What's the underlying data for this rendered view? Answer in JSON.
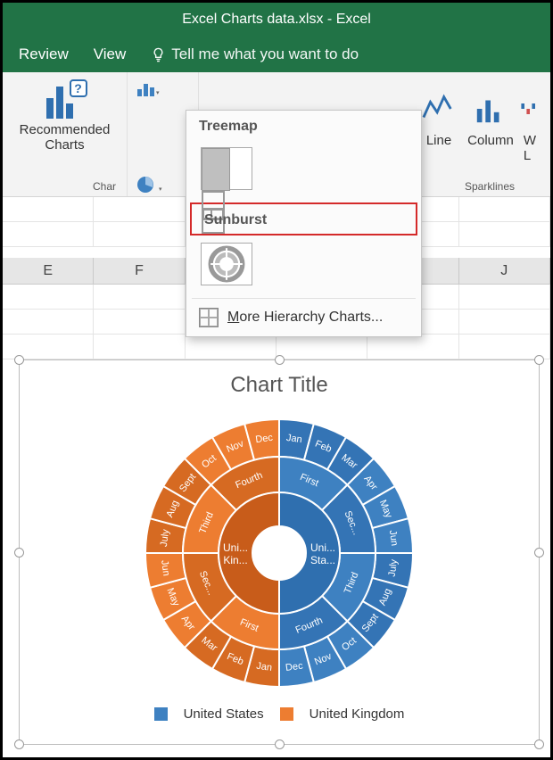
{
  "window": {
    "title": "Excel Charts data.xlsx - Excel"
  },
  "menu": {
    "review": "Review",
    "view": "View",
    "tellme": "Tell me what you want to do"
  },
  "ribbon": {
    "recommended": {
      "line1": "Recommended",
      "line2": "Charts"
    },
    "group_charts": "Char",
    "sparklines": {
      "line": "Line",
      "column": "Column",
      "winloss_initial": "W",
      "winloss_rest": "L",
      "group_label": "Sparklines"
    }
  },
  "dropdown": {
    "treemap_header": "Treemap",
    "sunburst_header": "Sunburst",
    "more_prefix": "M",
    "more_rest": "ore Hierarchy Charts..."
  },
  "columns": {
    "e": "E",
    "f": "F",
    "j": "J"
  },
  "chart": {
    "title": "Chart Title",
    "legend": {
      "us": "United States",
      "uk": "United Kingdom"
    }
  },
  "chart_data": {
    "type": "sunburst",
    "title": "Chart Title",
    "series": [
      {
        "name": "United States",
        "color": "#3e81c1",
        "children": [
          {
            "name": "First",
            "children": [
              {
                "name": "Jan",
                "value": 1
              },
              {
                "name": "Feb",
                "value": 1
              },
              {
                "name": "Mar",
                "value": 1
              }
            ]
          },
          {
            "name": "Sec...",
            "children": [
              {
                "name": "Apr",
                "value": 1
              },
              {
                "name": "May",
                "value": 1
              },
              {
                "name": "Jun",
                "value": 1
              }
            ]
          },
          {
            "name": "Third",
            "children": [
              {
                "name": "July",
                "value": 1
              },
              {
                "name": "Aug",
                "value": 1
              },
              {
                "name": "Sept",
                "value": 1
              }
            ]
          },
          {
            "name": "Fourth",
            "children": [
              {
                "name": "Oct",
                "value": 1
              },
              {
                "name": "Nov",
                "value": 1
              },
              {
                "name": "Dec",
                "value": 1
              }
            ]
          }
        ]
      },
      {
        "name": "United Kingdom",
        "color": "#ed7d31",
        "children": [
          {
            "name": "First",
            "children": [
              {
                "name": "Jan",
                "value": 1
              },
              {
                "name": "Feb",
                "value": 1
              },
              {
                "name": "Mar",
                "value": 1
              }
            ]
          },
          {
            "name": "Sec...",
            "children": [
              {
                "name": "Apr",
                "value": 1
              },
              {
                "name": "May",
                "value": 1
              },
              {
                "name": "Jun",
                "value": 1
              }
            ]
          },
          {
            "name": "Third",
            "children": [
              {
                "name": "July",
                "value": 1
              },
              {
                "name": "Aug",
                "value": 1
              },
              {
                "name": "Sept",
                "value": 1
              }
            ]
          },
          {
            "name": "Fourth",
            "children": [
              {
                "name": "Oct",
                "value": 1
              },
              {
                "name": "Nov",
                "value": 1
              },
              {
                "name": "Dec",
                "value": 1
              }
            ]
          }
        ]
      }
    ]
  }
}
